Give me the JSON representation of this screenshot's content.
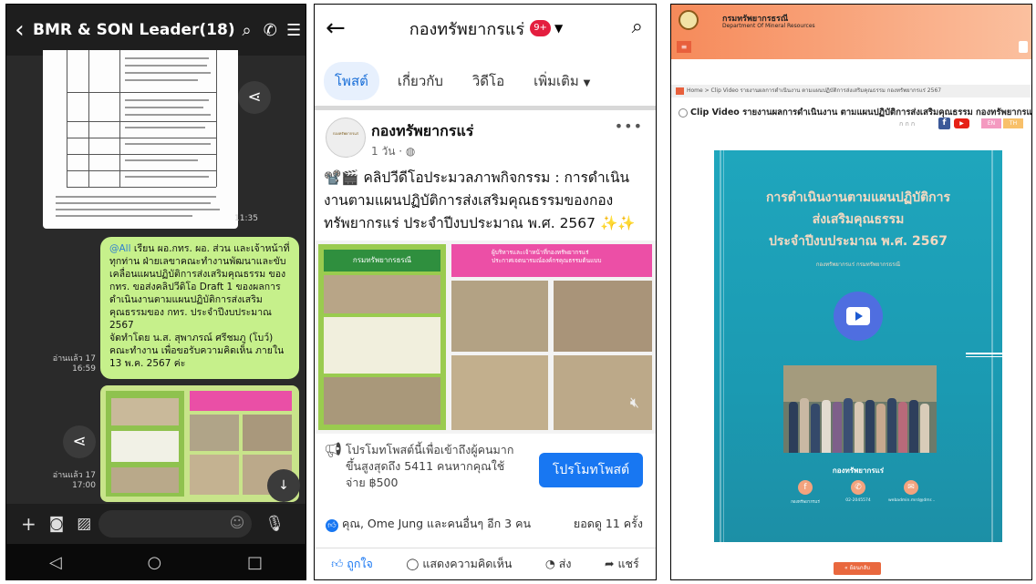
{
  "line_chat": {
    "title": "BMR & SON Leader(18)",
    "doc_time": "11:35",
    "message": {
      "mention": "@All",
      "line1": " เรียน ผอ.กทร. ผอ. ส่วน และเจ้าหน้าที่",
      "line2": "ทุกท่าน ฝ่ายเลขาคณะทำงานพัฒนาและขับ",
      "line3": "เคลื่อนแผนปฏิบัติการส่งเสริมคุณธรรม ของ",
      "line4": "กทร. ขอส่งคลิปวีดิโอ Draft 1 ของผลการ",
      "line5": "ดำเนินงานตามแผนปฏิบัติการส่งเสริม",
      "line6": "คุณธรรมของ กทร. ประจำปีงบประมาณ",
      "line7": "2567",
      "line8": "จัดทำโดย น.ส. สุพาภรณ์ ศรีชมภู (โบว์)",
      "line9": "คณะทำงาน เพื่อขอรับความคิดเห็น ภายใน",
      "line10": "13 พ.ค. 2567 ค่ะ"
    },
    "msg_read": "อ่านแล้ว 17",
    "msg_time": "16:59",
    "img_read": "อ่านแล้ว 17",
    "img_time": "17:00"
  },
  "facebook": {
    "page_title": "กองทรัพยากรแร่",
    "badge": "9+",
    "tabs": [
      "โพสต์",
      "เกี่ยวกับ",
      "วิดีโอ",
      "เพิ่มเติม"
    ],
    "post": {
      "page_name": "กองทรัพยากรแร่",
      "avatar_text": "กองทรัพยากรแร่",
      "time": "1 วัน ·",
      "line1": "📽️🎬 คลิปวีดีโอประมวลภาพกิจกรรม : การดำเนิน",
      "line2": "งานตามแผนปฏิบัติการส่งเสริมคุณธรรมของกอง",
      "line3": "ทรัพยากรแร่ ประจำปีงบประมาณ พ.ศ. 2567",
      "sparkles": "✨✨",
      "img_label1": "กรมทรัพยากรธรณี",
      "img_label2": "ผู้บริหารและเจ้าหน้าที่กองทรัพยากรแร่",
      "img_label3": "ประกาศเจตนารมณ์องค์กรคุณธรรมต้นแบบ"
    },
    "promo_line1": "โปรโมทโพสต์นี้เพื่อเข้าถึงผู้คนมาก",
    "promo_line2": "ขึ้นสูงสุดถึง 5411 คนหากคุณใช้",
    "promo_line3": "จ่าย ฿500",
    "promo_button": "โปรโมทโพสต์",
    "reactions": "คุณ, Ome Jung และคนอื่นๆ อีก 3 คน",
    "views": "ยอดดู 11 ครั้ง",
    "actions": [
      "ถูกใจ",
      "แสดงความคิดเห็น",
      "ส่ง",
      "แชร์"
    ]
  },
  "website": {
    "org_th": "กรมทรัพยากรธรณี",
    "org_en": "Department Of Mineral Resources",
    "font_sizes": "ก ก ก",
    "breadcrumb": "Home > Clip Video รายงานผลการดำเนินงาน ตามแผนปฏิบัติการส่งเสริมคุณธรรม กองทรัพยากรแร่ 2567",
    "page_heading": "Clip Video รายงานผลการดำเนินงาน ตามแผนปฏิบัติการส่งเสริมคุณธรรม กองทรัพยากรแร่ 2567",
    "poster_line1": "การดำเนินงานตามแผนปฏิบัติการ",
    "poster_line2": "ส่งเสริมคุณธรรม",
    "poster_line3": "ประจำปีงบประมาณ พ.ศ. 2567",
    "poster_sub": "กองทรัพยากรแร่ กรมทรัพยากรธรณี",
    "poster_caption": "กองทรัพยากรแร่",
    "contact_fb": "กองทรัพยากรแร่",
    "contact_phone": "02-2045574",
    "contact_mail": "webadmin.mrd@dmr...",
    "back_button": "« ย้อนกลับ"
  },
  "colors": {
    "line_bg": "#2a2a2a",
    "line_bubble": "#c6f08b",
    "fb_blue": "#1877f2",
    "dmr_orange": "#f68a5a",
    "poster_teal": "#1fa6bd"
  }
}
